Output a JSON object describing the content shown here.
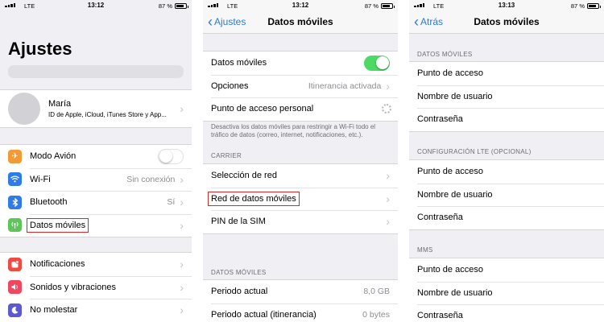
{
  "status": {
    "panel1": {
      "carrier": "LTE",
      "time": "13:12",
      "battery": "87 %"
    },
    "panel2": {
      "carrier": "LTE",
      "time": "13:12",
      "battery": "87 %"
    },
    "panel3": {
      "carrier": "LTE",
      "time": "13:13",
      "battery": "87 %"
    }
  },
  "settings": {
    "title": "Ajustes",
    "profile": {
      "name": "María",
      "subtitle": "ID de Apple, iCloud, iTunes Store y App..."
    },
    "items": [
      {
        "label": "Modo Avión",
        "icon": "airplane-icon",
        "color": "#f29a38"
      },
      {
        "label": "Wi-Fi",
        "value": "Sin conexión",
        "icon": "wifi-icon",
        "color": "#2f7be8"
      },
      {
        "label": "Bluetooth",
        "value": "Sí",
        "icon": "bluetooth-icon",
        "color": "#2f7be8"
      },
      {
        "label": "Datos móviles",
        "icon": "antenna-icon",
        "color": "#5fc55a"
      }
    ],
    "items2": [
      {
        "label": "Notificaciones",
        "icon": "notifications-icon",
        "color": "#f04a43"
      },
      {
        "label": "Sonidos y vibraciones",
        "icon": "speaker-icon",
        "color": "#f0465e"
      },
      {
        "label": "No molestar",
        "icon": "moon-icon",
        "color": "#5d5ad1"
      }
    ]
  },
  "cellular": {
    "back": "Ajustes",
    "title": "Datos móviles",
    "rows": [
      {
        "label": "Datos móviles"
      },
      {
        "label": "Opciones",
        "value": "Itinerancia activada"
      },
      {
        "label": "Punto de acceso personal"
      }
    ],
    "footnote": "Desactiva los datos móviles para restringir a Wi-Fi todo el tráfico de datos (correo, internet, notificaciones, etc.).",
    "carrier_header": "CARRIER",
    "carrier_rows": [
      {
        "label": "Selección de red"
      },
      {
        "label": "Red de datos móviles"
      },
      {
        "label": "PIN de la SIM"
      }
    ],
    "usage_header": "DATOS MÓVILES",
    "usage_rows": [
      {
        "label": "Periodo actual",
        "value": "8,0 GB"
      },
      {
        "label": "Periodo actual (itinerancia)",
        "value": "0 bytes"
      }
    ]
  },
  "network": {
    "back": "Atrás",
    "title": "Datos móviles",
    "sections": [
      {
        "header": "DATOS MÓVILES",
        "rows": [
          "Punto de acceso",
          "Nombre de usuario",
          "Contraseña"
        ]
      },
      {
        "header": "CONFIGURACIÓN LTE (OPCIONAL)",
        "rows": [
          "Punto de acceso",
          "Nombre de usuario",
          "Contraseña"
        ]
      },
      {
        "header": "MMS",
        "rows": [
          "Punto de acceso",
          "Nombre de usuario",
          "Contraseña"
        ]
      }
    ]
  },
  "colors": {
    "accent": "#2a7ae2",
    "toggle_on": "#4cd964",
    "highlight": "#d12b2b"
  }
}
